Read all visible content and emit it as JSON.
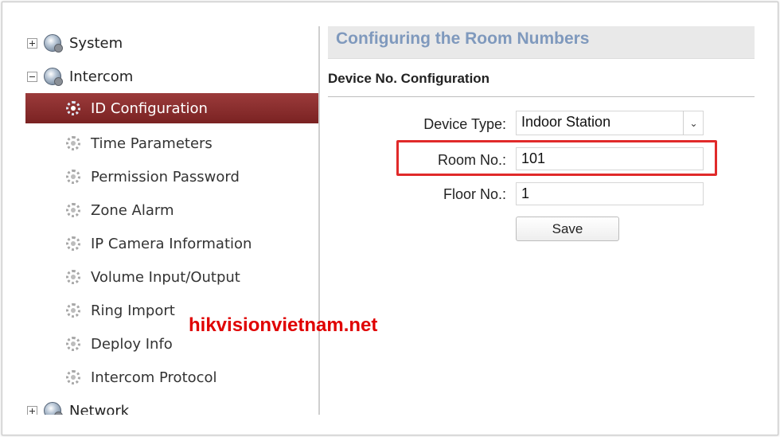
{
  "sidebar": {
    "top_items": [
      {
        "label": "System",
        "expander": "+"
      },
      {
        "label": "Intercom",
        "expander": "-"
      }
    ],
    "intercom_children": [
      {
        "label": "ID Configuration",
        "active": true
      },
      {
        "label": "Time Parameters",
        "active": false
      },
      {
        "label": "Permission Password",
        "active": false
      },
      {
        "label": "Zone Alarm",
        "active": false
      },
      {
        "label": "IP Camera Information",
        "active": false
      },
      {
        "label": "Volume Input/Output",
        "active": false
      },
      {
        "label": "Ring Import",
        "active": false
      },
      {
        "label": "Deploy Info",
        "active": false
      },
      {
        "label": "Intercom Protocol",
        "active": false
      }
    ],
    "bottom_item": {
      "label": "Network",
      "expander": "+"
    }
  },
  "content": {
    "title": "Configuring the Room Numbers",
    "section_title": "Device No. Configuration",
    "device_type": {
      "label": "Device Type:",
      "value": "Indoor Station"
    },
    "room_no": {
      "label": "Room No.:",
      "value": "101"
    },
    "floor_no": {
      "label": "Floor No.:",
      "value": "1"
    },
    "save_label": "Save"
  },
  "watermark": "hikvisionvietnam.net",
  "colors": {
    "active_row": "#8a2c2c",
    "title_blue": "#7f99bd",
    "highlight_red": "#e02a2a",
    "watermark_red": "#e00000"
  }
}
